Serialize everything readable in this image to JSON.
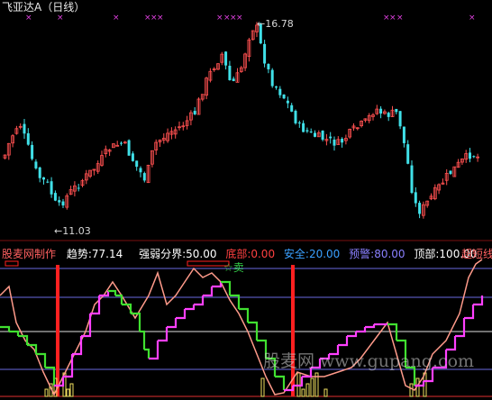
{
  "title": "飞亚达A（日线）",
  "price_panel": {
    "high_label": "16.78",
    "low_label": "11.03",
    "arrow_hi": "←",
    "arrow_lo": "←"
  },
  "indicator": {
    "name": "股麦网制作",
    "trend_label": "趋势:",
    "trend_value": "77.14",
    "divide_label": "强弱分界:",
    "divide_value": "50.00",
    "bottom_label": "底部:",
    "bottom_value": "0.00",
    "safe_label": "安全:",
    "safe_value": "20.00",
    "warn_label": "预警:",
    "warn_value": "80.00",
    "top_label": "顶部:",
    "top_value": "100.00",
    "super_short": "超短线",
    "sell_marker": "☆卖"
  },
  "watermark": "股麦网 www.gupang.com",
  "colors": {
    "background": "#000000",
    "up_candle": "#ff5050",
    "down_candle": "#40e0e8",
    "x_marker": "#e040e0",
    "trend_line": "#ff9a8a",
    "magenta_line": "#ff40ff",
    "green_line": "#40e030",
    "red_bar": "#ff2020",
    "yellow_bar": "#f0e060",
    "level_blue": "#6a6ae0",
    "level_white": "#e0e0e0",
    "level_red": "#e03030",
    "trend_color": "#ffffff",
    "divide_color": "#ffffff",
    "bottom_color": "#ff3030",
    "safe_color": "#3aa0ff",
    "warn_color": "#8a80ff",
    "top_color": "#ffffff"
  }
}
